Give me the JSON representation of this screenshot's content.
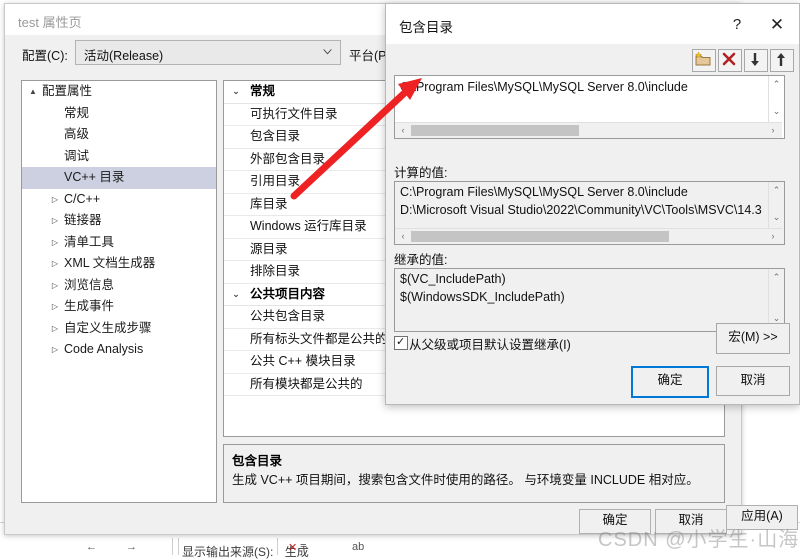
{
  "background": {
    "output_source_label": "显示输出来源(S):",
    "output_source_value": "生成"
  },
  "property_window": {
    "title": "test 属性页",
    "config": {
      "label": "配置(C):",
      "value": "活动(Release)",
      "platform_label": "平台(P)"
    },
    "tree": [
      {
        "label": "配置属性",
        "expander": "▲",
        "indent": 20,
        "level": 0,
        "selected": false
      },
      {
        "label": "常规",
        "expander": "",
        "indent": 42,
        "level": 1,
        "selected": false
      },
      {
        "label": "高级",
        "expander": "",
        "indent": 42,
        "level": 1,
        "selected": false
      },
      {
        "label": "调试",
        "expander": "",
        "indent": 42,
        "level": 1,
        "selected": false
      },
      {
        "label": "VC++ 目录",
        "expander": "",
        "indent": 42,
        "level": 1,
        "selected": true
      },
      {
        "label": "C/C++",
        "expander": "▷",
        "indent": 42,
        "level": 1,
        "selected": false
      },
      {
        "label": "链接器",
        "expander": "▷",
        "indent": 42,
        "level": 1,
        "selected": false
      },
      {
        "label": "清单工具",
        "expander": "▷",
        "indent": 42,
        "level": 1,
        "selected": false
      },
      {
        "label": "XML 文档生成器",
        "expander": "▷",
        "indent": 42,
        "level": 1,
        "selected": false
      },
      {
        "label": "浏览信息",
        "expander": "▷",
        "indent": 42,
        "level": 1,
        "selected": false
      },
      {
        "label": "生成事件",
        "expander": "▷",
        "indent": 42,
        "level": 1,
        "selected": false
      },
      {
        "label": "自定义生成步骤",
        "expander": "▷",
        "indent": 42,
        "level": 1,
        "selected": false
      },
      {
        "label": "Code Analysis",
        "expander": "▷",
        "indent": 42,
        "level": 1,
        "selected": false
      }
    ],
    "property_groups": [
      {
        "name": "常规",
        "chevron": "⌄",
        "rows": [
          {
            "label": "可执行文件目录"
          },
          {
            "label": "包含目录"
          },
          {
            "label": "外部包含目录"
          },
          {
            "label": "引用目录"
          },
          {
            "label": "库目录"
          },
          {
            "label": "Windows 运行库目录"
          },
          {
            "label": "源目录"
          },
          {
            "label": "排除目录"
          }
        ]
      },
      {
        "name": "公共项目内容",
        "chevron": "⌄",
        "rows": [
          {
            "label": "公共包含目录"
          },
          {
            "label": "所有标头文件都是公共的"
          },
          {
            "label": "公共 C++ 模块目录"
          },
          {
            "label": "所有模块都是公共的"
          }
        ]
      }
    ],
    "description": {
      "title": "包含目录",
      "body": "生成 VC++ 项目期间，搜索包含文件时使用的路径。  与环境变量 INCLUDE 相对应。"
    },
    "buttons": {
      "ok": "确定",
      "cancel": "取消",
      "apply": "应用(A)"
    }
  },
  "dialog": {
    "title": "包含目录",
    "help_glyph": "?",
    "close_glyph": "✕",
    "toolbar": [
      {
        "name": "new-folder",
        "tooltip": "新行"
      },
      {
        "name": "delete",
        "tooltip": "删除"
      },
      {
        "name": "move-down",
        "tooltip": "下移"
      },
      {
        "name": "move-up",
        "tooltip": "上移"
      }
    ],
    "value_entries": [
      "C:\\Program Files\\MySQL\\MySQL Server 8.0\\include"
    ],
    "computed": {
      "label": "计算的值:",
      "lines": [
        "C:\\Program Files\\MySQL\\MySQL Server 8.0\\include",
        "D:\\Microsoft Visual Studio\\2022\\Community\\VC\\Tools\\MSVC\\14.3"
      ]
    },
    "inherited": {
      "label": "继承的值:",
      "lines": [
        "$(VC_IncludePath)",
        "$(WindowsSDK_IncludePath)"
      ]
    },
    "inherit_checkbox": {
      "label": "从父级或项目默认设置继承(I)",
      "checked": true,
      "tick": "✓"
    },
    "macro_button": "宏(M) >>",
    "buttons": {
      "ok": "确定",
      "cancel": "取消"
    }
  },
  "annotation": {
    "arrow_color": "#ee2222"
  },
  "watermark": "CSDN @小学生·山海"
}
